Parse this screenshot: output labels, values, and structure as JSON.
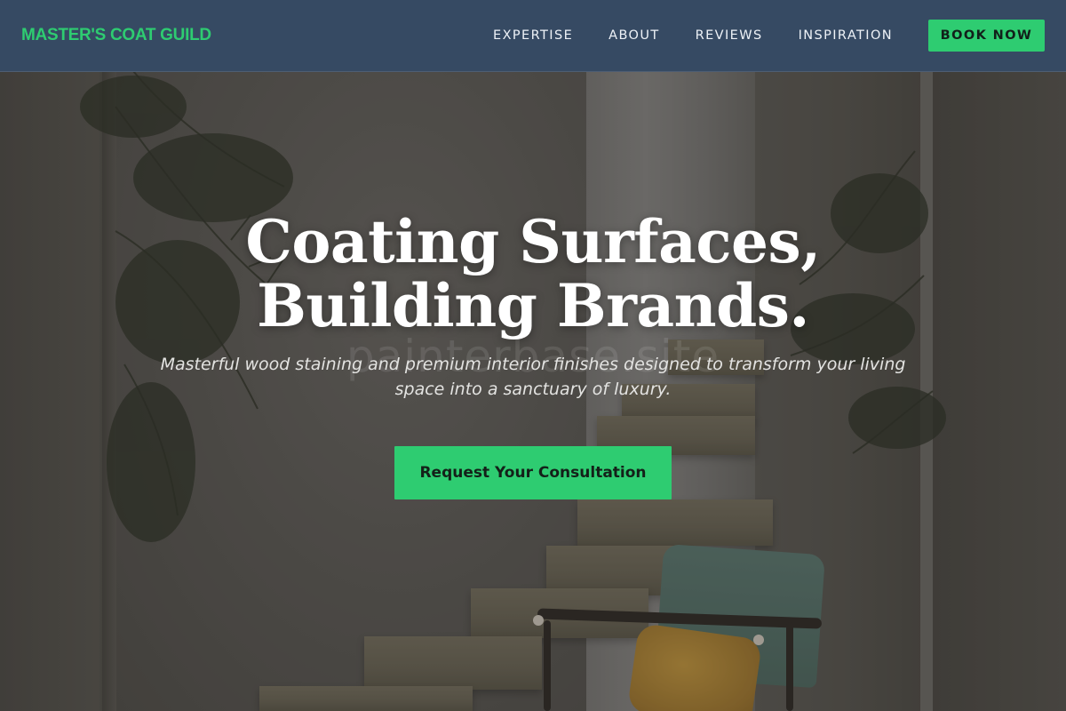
{
  "navbar": {
    "logo": "MASTER'S COAT GUILD",
    "links": [
      {
        "label": "EXPERTISE"
      },
      {
        "label": "ABOUT"
      },
      {
        "label": "REVIEWS"
      },
      {
        "label": "INSPIRATION"
      }
    ],
    "cta_label": "BOOK NOW"
  },
  "hero": {
    "title_line_1": "Coating Surfaces,",
    "title_line_2": "Building Brands.",
    "subtitle": "Masterful wood staining and premium interior finishes designed to transform your living space into a sanctuary of luxury.",
    "watermark": "painterbase.site",
    "cta_label": "Request Your Consultation"
  },
  "colors": {
    "accent": "#2ecc71",
    "navbar_bg": "#364a63",
    "nav_text": "#eef2f7",
    "title_text": "#ffffff"
  }
}
